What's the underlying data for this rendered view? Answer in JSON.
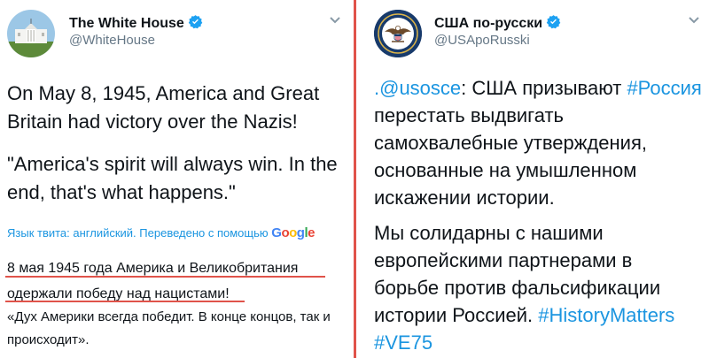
{
  "left_tweet": {
    "author_name": "The White House",
    "author_handle": "@WhiteHouse",
    "text_line1": "On May 8, 1945, America and Great Britain had victory over the Nazis!",
    "text_line2": "\"America's spirit will always win. In the end, that's what happens.\"",
    "translation_note": "Язык твита: английский. Переведено с помощью",
    "translation_logo": "Google",
    "translation_text": "8 мая 1945 года Америка и Великобритания одержали победу над нацистами!",
    "translation_quote": "«Дух Америки всегда победит. В конце концов, так и происходит»."
  },
  "right_tweet": {
    "author_name": "США по-русски",
    "author_handle": "@USApoRusski",
    "mention": ".@usosce",
    "text_part1": ": США призывают ",
    "hashtag1": "#Россия",
    "text_part2": " перестать выдвигать самохвалебные утверждения, основанные на умышленном искажении истории.",
    "text_part3": "Мы солидарны с нашими европейскими партнерами в борьбе против фальсификации истории Россией. ",
    "hashtag2": "#HistoryMatters",
    "hashtag3": "#VE75"
  },
  "colors": {
    "link_blue": "#1b95e0",
    "verified_blue": "#1da1f2",
    "divider_red": "#e0534a",
    "handle_gray": "#657786"
  },
  "icons": [
    "white-house-avatar",
    "state-department-seal-avatar",
    "verified-badge-icon",
    "chevron-down-icon",
    "google-logo"
  ]
}
